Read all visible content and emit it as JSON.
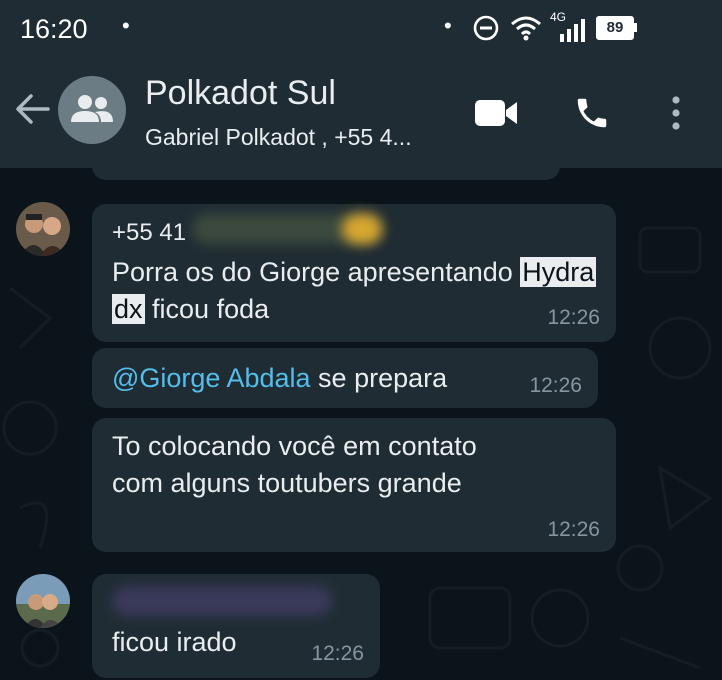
{
  "status_bar": {
    "time": "16:20",
    "dot": "•",
    "network": "4G",
    "battery": "89"
  },
  "header": {
    "title": "Polkadot Sul",
    "subtitle": "Gabriel Polkadot , +55 4..."
  },
  "messages": [
    {
      "sender": "+55 41",
      "text_parts": [
        "Porra os do Giorge apresentando ",
        "Hydra",
        " ",
        "dx",
        " ficou foda"
      ],
      "time": "12:26"
    },
    {
      "mention": "@Giorge Abdala",
      "text": " se prepara",
      "time": "12:26"
    },
    {
      "line1": "To colocando você em contato",
      "line2": "com alguns toutubers grande",
      "time": "12:26"
    },
    {
      "text": "ficou irado",
      "time": "12:26"
    }
  ],
  "icons": {
    "back": "arrow-back-icon",
    "group": "group-icon",
    "video": "video-call-icon",
    "phone": "phone-icon",
    "menu": "more-vert-icon"
  },
  "colors": {
    "header_bg": "#1f2c34",
    "chat_bg": "#0b141a",
    "bubble_bg": "#202c33",
    "mention": "#53bdeb",
    "sender": "#a5b337",
    "time": "#8696a0"
  }
}
